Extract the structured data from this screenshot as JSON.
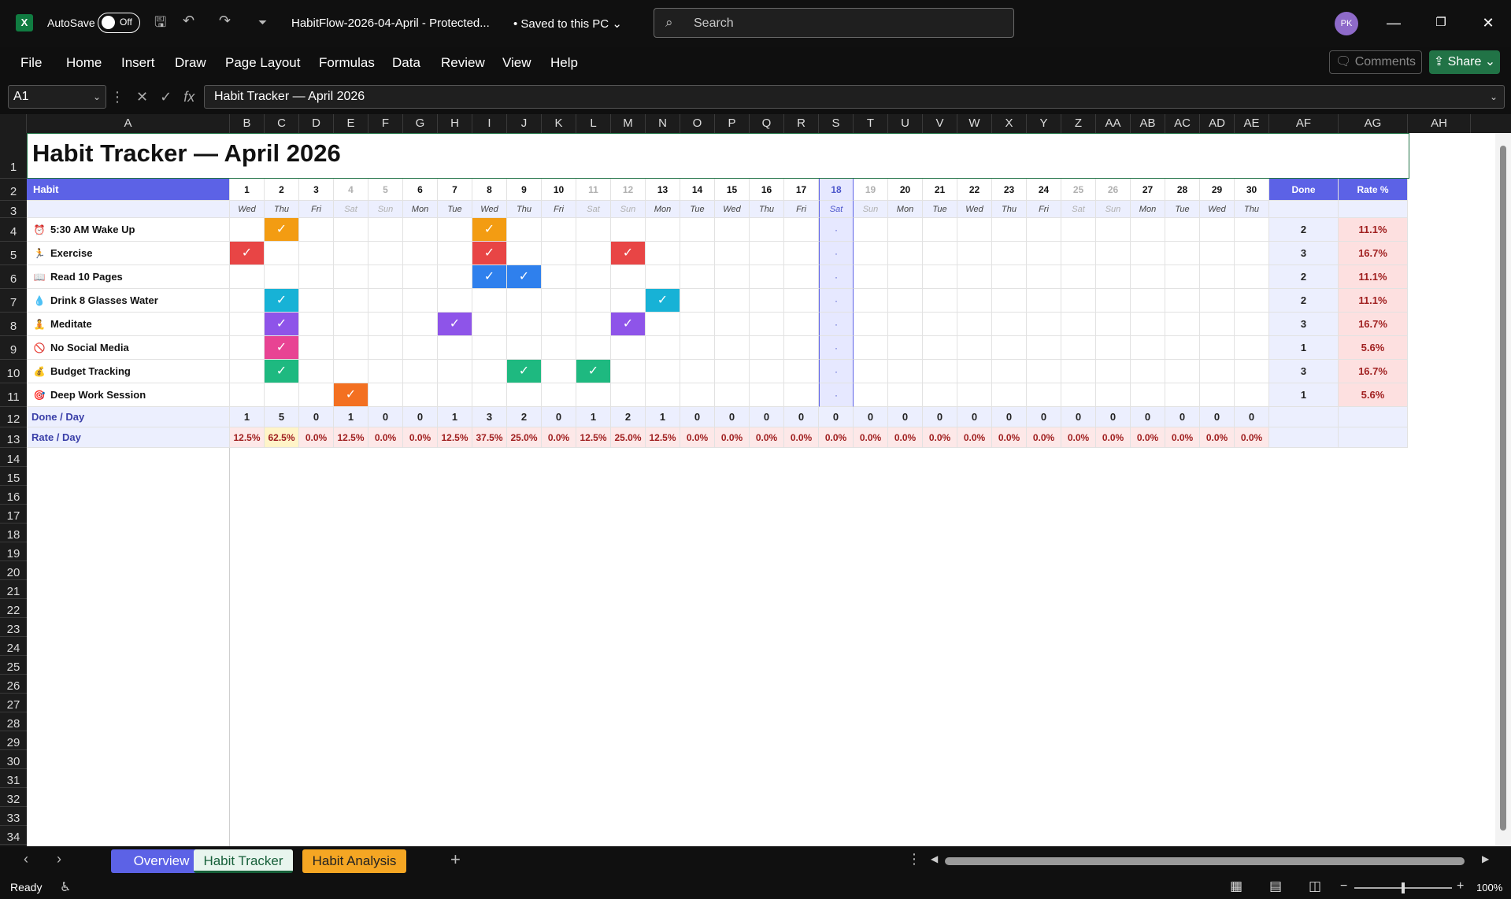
{
  "titlebar": {
    "autosave_label": "AutoSave",
    "autosave_state": "Off",
    "doc_title": "HabitFlow-2026-04-April  -  Protected...",
    "saved_status": "• Saved to this PC",
    "search_placeholder": "Search",
    "avatar_initials": "PK"
  },
  "menu": [
    "File",
    "Home",
    "Insert",
    "Draw",
    "Page Layout",
    "Formulas",
    "Data",
    "Review",
    "View",
    "Help"
  ],
  "comments_label": "Comments",
  "share_label": "Share",
  "formula_bar": {
    "name_box": "A1",
    "formula": "Habit Tracker  —  April 2026"
  },
  "columns": [
    "A",
    "B",
    "C",
    "D",
    "E",
    "F",
    "G",
    "H",
    "I",
    "J",
    "K",
    "L",
    "M",
    "N",
    "O",
    "P",
    "Q",
    "R",
    "S",
    "T",
    "U",
    "V",
    "W",
    "X",
    "Y",
    "Z",
    "AA",
    "AB",
    "AC",
    "AD",
    "AE",
    "AF",
    "AG",
    "AH"
  ],
  "sheet": {
    "title": "Habit Tracker  —  April 2026",
    "habit_header": "Habit",
    "done_header": "Done",
    "rate_header": "Rate %",
    "today_day": 18,
    "days": [
      1,
      2,
      3,
      4,
      5,
      6,
      7,
      8,
      9,
      10,
      11,
      12,
      13,
      14,
      15,
      16,
      17,
      18,
      19,
      20,
      21,
      22,
      23,
      24,
      25,
      26,
      27,
      28,
      29,
      30
    ],
    "weekdays": [
      "Wed",
      "Thu",
      "Fri",
      "Sat",
      "Sun",
      "Mon",
      "Tue",
      "Wed",
      "Thu",
      "Fri",
      "Sat",
      "Sun",
      "Mon",
      "Tue",
      "Wed",
      "Thu",
      "Fri",
      "Sat",
      "Sun",
      "Mon",
      "Tue",
      "Wed",
      "Thu",
      "Fri",
      "Sat",
      "Sun",
      "Mon",
      "Tue",
      "Wed",
      "Thu"
    ],
    "habits": [
      {
        "name": "5:30 AM Wake Up",
        "icon": "alarm-icon",
        "glyph": "⏰",
        "color": "#f39c12",
        "checks": [
          2,
          8
        ],
        "done": "2",
        "rate": "11.1%"
      },
      {
        "name": "Exercise",
        "icon": "run-icon",
        "glyph": "🏃",
        "color": "#e84545",
        "checks": [
          1,
          8,
          12
        ],
        "done": "3",
        "rate": "16.7%"
      },
      {
        "name": "Read 10 Pages",
        "icon": "book-icon",
        "glyph": "📖",
        "color": "#2f80ed",
        "checks": [
          8,
          9
        ],
        "done": "2",
        "rate": "11.1%"
      },
      {
        "name": "Drink 8 Glasses Water",
        "icon": "water-drop-icon",
        "glyph": "💧",
        "color": "#17b2d6",
        "checks": [
          2,
          13
        ],
        "done": "2",
        "rate": "11.1%"
      },
      {
        "name": "Meditate",
        "icon": "meditate-icon",
        "glyph": "🧘",
        "color": "#8e54e9",
        "checks": [
          2,
          7,
          12
        ],
        "done": "3",
        "rate": "16.7%"
      },
      {
        "name": "No Social Media",
        "icon": "no-phone-icon",
        "glyph": "🚫",
        "color": "#e84393",
        "checks": [
          2
        ],
        "done": "1",
        "rate": "5.6%"
      },
      {
        "name": "Budget Tracking",
        "icon": "money-bag-icon",
        "glyph": "💰",
        "color": "#1eb980",
        "checks": [
          2,
          9,
          11
        ],
        "done": "3",
        "rate": "16.7%"
      },
      {
        "name": "Deep Work Session",
        "icon": "target-icon",
        "glyph": "🎯",
        "color": "#f37021",
        "checks": [
          4
        ],
        "done": "1",
        "rate": "5.6%"
      }
    ],
    "check_mark": "✓",
    "today_placeholder": "·",
    "done_per_day_label": "Done / Day",
    "rate_per_day_label": "Rate / Day",
    "done_per_day": [
      "1",
      "5",
      "0",
      "1",
      "0",
      "0",
      "1",
      "3",
      "2",
      "0",
      "1",
      "2",
      "1",
      "0",
      "0",
      "0",
      "0",
      "0",
      "0",
      "0",
      "0",
      "0",
      "0",
      "0",
      "0",
      "0",
      "0",
      "0",
      "0",
      "0"
    ],
    "rate_per_day": [
      "12.5%",
      "62.5%",
      "0.0%",
      "12.5%",
      "0.0%",
      "0.0%",
      "12.5%",
      "37.5%",
      "25.0%",
      "0.0%",
      "12.5%",
      "25.0%",
      "12.5%",
      "0.0%",
      "0.0%",
      "0.0%",
      "0.0%",
      "0.0%",
      "0.0%",
      "0.0%",
      "0.0%",
      "0.0%",
      "0.0%",
      "0.0%",
      "0.0%",
      "0.0%",
      "0.0%",
      "0.0%",
      "0.0%",
      "0.0%"
    ]
  },
  "rows": [
    1,
    2,
    3,
    4,
    5,
    6,
    7,
    8,
    9,
    10,
    11,
    12,
    13,
    14,
    15,
    16,
    17,
    18,
    19,
    20,
    21,
    22,
    23,
    24,
    25,
    26,
    27,
    28,
    29,
    30,
    31,
    32,
    33,
    34
  ],
  "tabs": {
    "overview": "Overview",
    "habit_tracker": "Habit Tracker",
    "habit_analysis": "Habit Analysis"
  },
  "status": {
    "ready": "Ready",
    "zoom": "100%"
  }
}
